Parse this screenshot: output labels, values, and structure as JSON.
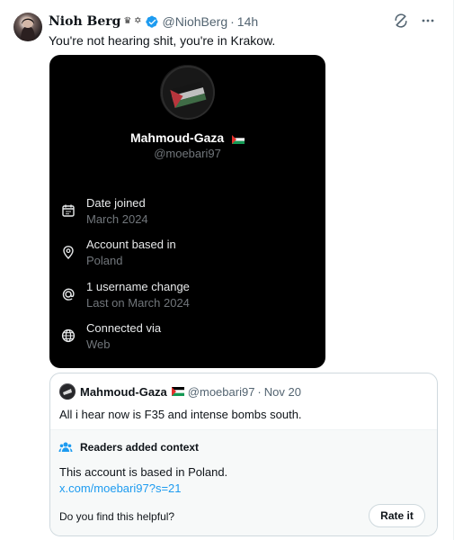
{
  "post": {
    "display_name": "Nioh Berg",
    "name_marks": "♛ ✡",
    "handle": "@NiohBerg",
    "separator": "·",
    "time": "14h",
    "text": "You're not hearing shit, you're in Krakow.",
    "header_icons": [
      "grok-icon",
      "more-icon"
    ]
  },
  "profile_card": {
    "name": "Mahmoud-Gaza",
    "handle": "@moebari97",
    "rows": [
      {
        "icon": "calendar-icon",
        "title": "Date joined",
        "value": "March 2024"
      },
      {
        "icon": "location-icon",
        "title": "Account based in",
        "value": "Poland"
      },
      {
        "icon": "at-icon",
        "title": "1 username change",
        "value": "Last on March 2024"
      },
      {
        "icon": "globe-icon",
        "title": "Connected via",
        "value": "Web"
      }
    ]
  },
  "quote": {
    "name": "Mahmoud-Gaza",
    "handle": "@moebari97",
    "separator": "·",
    "date": "Nov 20",
    "text": "All i hear now is F35 and intense bombs south."
  },
  "context": {
    "title": "Readers added context",
    "text": "This account is based in Poland.",
    "link": "x.com/moebari97?s=21",
    "question": "Do you find this helpful?",
    "button": "Rate it"
  },
  "colors": {
    "verified": "#1d9bf0",
    "card_background": "#000000",
    "muted_text": "#536471",
    "link": "#1d9bf0",
    "context_icon": "#1d9bf0"
  }
}
